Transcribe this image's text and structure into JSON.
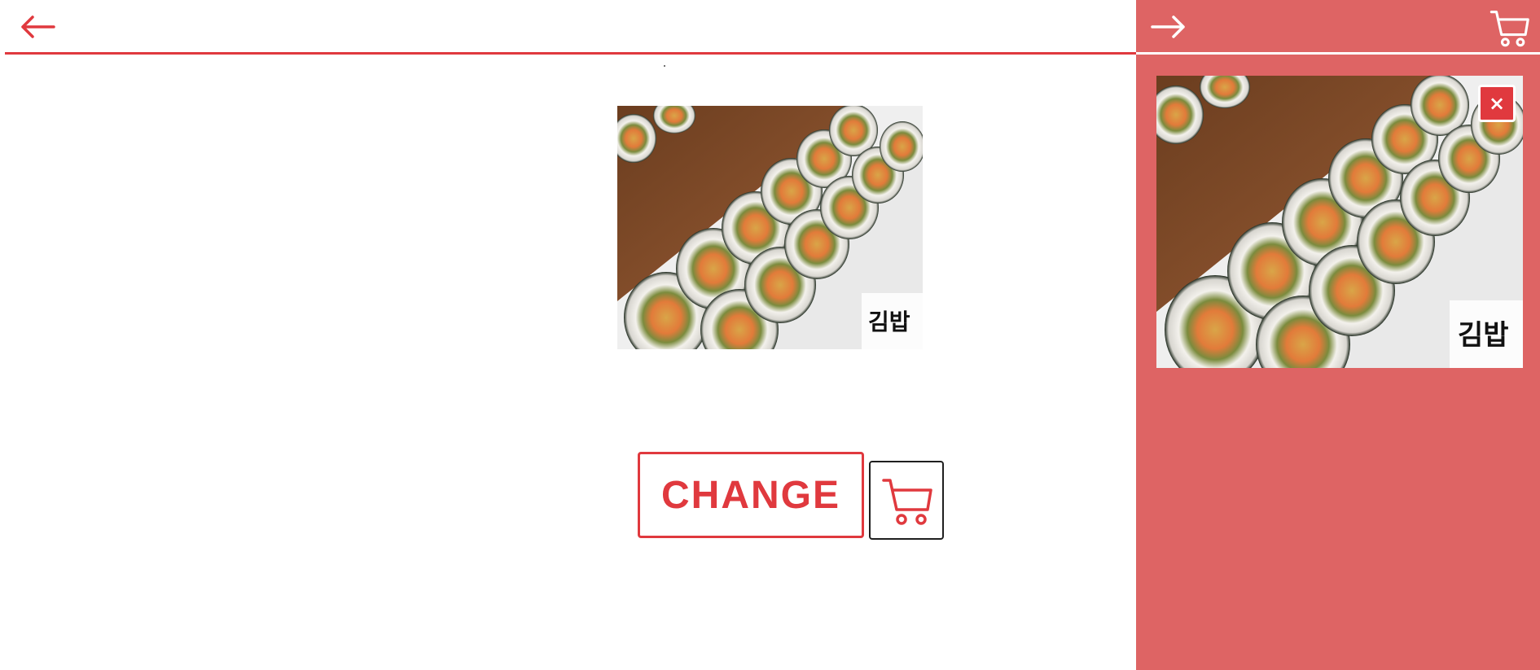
{
  "header": {
    "back_icon": "arrow-left-icon",
    "accent_color": "#e0393e"
  },
  "product": {
    "image_label": "김밥",
    "image_icon": "gimbap-photo"
  },
  "actions": {
    "change_label": "CHANGE",
    "cart_icon": "shopping-cart-icon"
  },
  "side_panel": {
    "background_color": "#de6464",
    "forward_icon": "arrow-right-icon",
    "cart_icon": "shopping-cart-icon",
    "close_label": "×",
    "image_label": "김밥"
  }
}
